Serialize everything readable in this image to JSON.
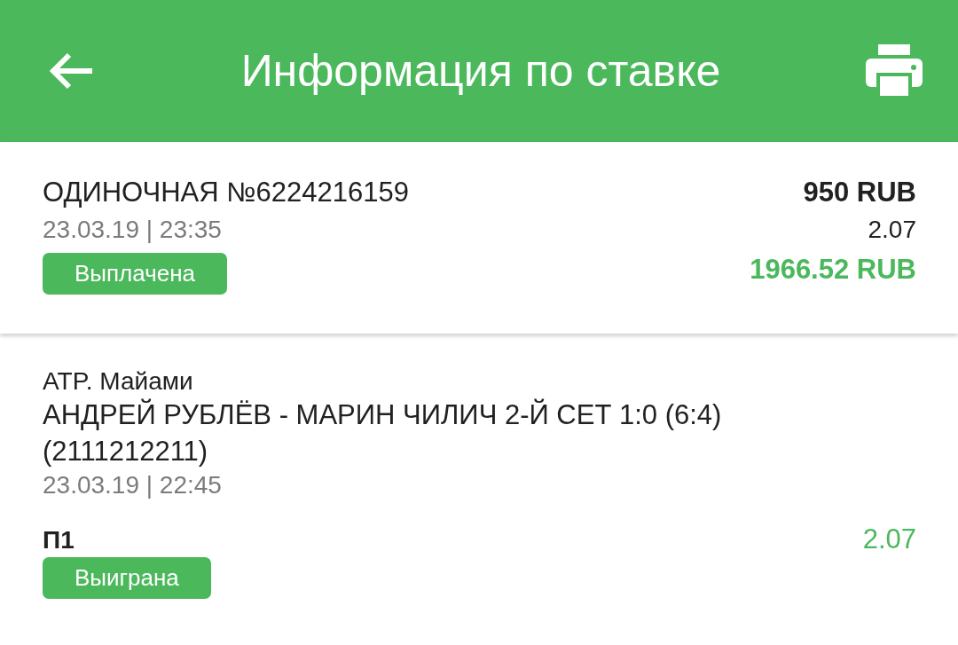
{
  "header": {
    "title": "Информация по ставке"
  },
  "bet": {
    "title": "ОДИНОЧНАЯ №6224216159",
    "date": "23.03.19 | 23:35",
    "status": "Выплачена",
    "stake": "950 RUB",
    "odds": "2.07",
    "payout": "1966.52 RUB"
  },
  "events": [
    {
      "tournament": "ATP. Майами",
      "match": "АНДРЕЙ РУБЛЁВ - МАРИН ЧИЛИЧ 2-Й СЕТ 1:0 (6:4) (2111212211)",
      "date": "23.03.19 | 22:45",
      "outcome": "П1",
      "odds": "2.07",
      "status": "Выиграна"
    }
  ]
}
